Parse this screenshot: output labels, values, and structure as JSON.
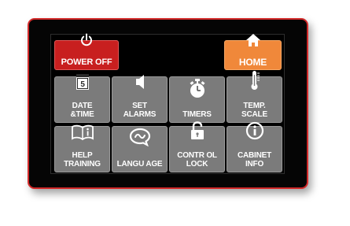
{
  "header": {
    "power_label": "POWER OFF",
    "home_label": "HOME"
  },
  "tiles": [
    {
      "label": "DATE\n&TIME",
      "icon": "calendar-icon",
      "day": "5"
    },
    {
      "label": "SET\nALARMS",
      "icon": "speaker-icon"
    },
    {
      "label": "TIMERS",
      "icon": "stopwatch-icon"
    },
    {
      "label": "TEMP.\nSCALE",
      "icon": "thermometer-icon"
    },
    {
      "label": "HELP\nTRAINING",
      "icon": "book-info-icon"
    },
    {
      "label": "LANGU AGE",
      "icon": "speech-bubble-icon"
    },
    {
      "label": "CONTR OL\nLOCK",
      "icon": "unlock-icon"
    },
    {
      "label": "CABINET\nINFO",
      "icon": "info-icon"
    }
  ],
  "colors": {
    "bezel_border": "#d32a2a",
    "power_button": "#c81f1f",
    "home_button": "#f0883a",
    "tile": "#7b7b7b"
  }
}
